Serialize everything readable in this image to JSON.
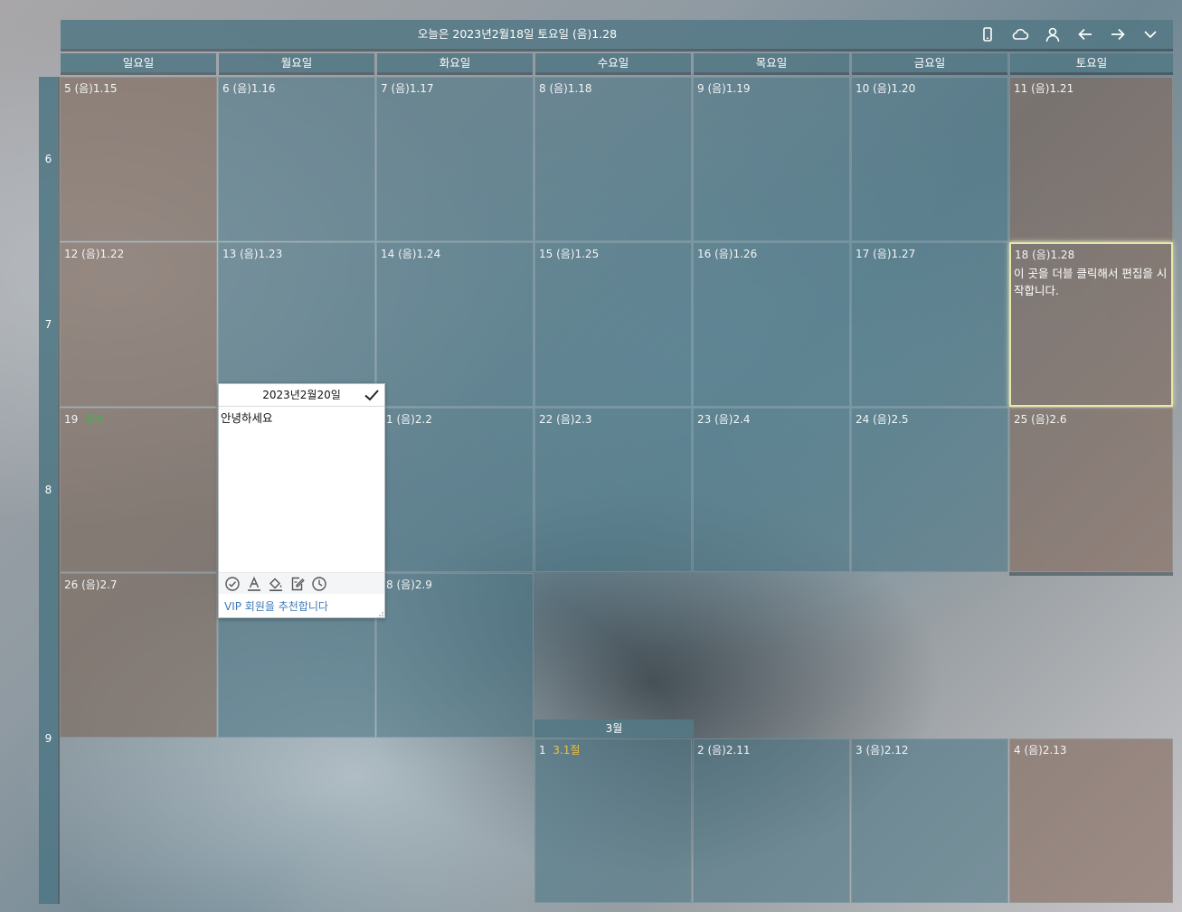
{
  "header": {
    "today_text": "오늘은 2023년2월18일 토요일 (음)1.28",
    "icons": [
      "phone-icon",
      "cloud-icon",
      "person-icon",
      "arrow-left-icon",
      "arrow-right-icon",
      "chevron-down-icon"
    ]
  },
  "weekdays": [
    "일요일",
    "월요일",
    "화요일",
    "수요일",
    "목요일",
    "금요일",
    "토요일"
  ],
  "week_numbers": [
    "6",
    "7",
    "8",
    "9"
  ],
  "weeks": [
    [
      "5  (음)1.15",
      "6  (음)1.16",
      "7  (음)1.17",
      "8  (음)1.18",
      "9  (음)1.19",
      "10  (음)1.20",
      "11  (음)1.21"
    ],
    [
      "12  (음)1.22",
      "13  (음)1.23",
      "14  (음)1.24",
      "15  (음)1.25",
      "16  (음)1.26",
      "17  (음)1.27",
      "18  (음)1.28"
    ],
    [
      "19",
      "",
      "1  (음)2.2",
      "22  (음)2.3",
      "23  (음)2.4",
      "24  (음)2.5",
      "25  (음)2.6"
    ],
    [
      "26  (음)2.7",
      "",
      "8  (음)2.9"
    ]
  ],
  "week3_sun_extra": "우수",
  "today_note": "이 곳을 더블 클릭해서 편집을 시작합니다.",
  "next_month": {
    "label": "3월",
    "days": [
      {
        "day": "1",
        "extra": "3.1절"
      },
      {
        "day": "2  (음)2.11",
        "extra": ""
      },
      {
        "day": "3  (음)2.12",
        "extra": ""
      },
      {
        "day": "4  (음)2.13",
        "extra": ""
      }
    ]
  },
  "popup": {
    "title": "2023년2월20일",
    "text": "안녕하세요",
    "tools": [
      "check-circle-icon",
      "text-color-icon",
      "fill-color-icon",
      "edit-note-icon",
      "clock-icon"
    ],
    "vip_link": "VIP 회원을 추천합니다"
  },
  "colors": {
    "header_bg": "#547985",
    "weekday_cell": "#4c7686",
    "weekend_cell": "#80665a",
    "today_border": "#e8e6a8",
    "holiday_text": "#f0c040",
    "solar_term_text": "#2fbf3f",
    "link": "#3e79b8"
  }
}
